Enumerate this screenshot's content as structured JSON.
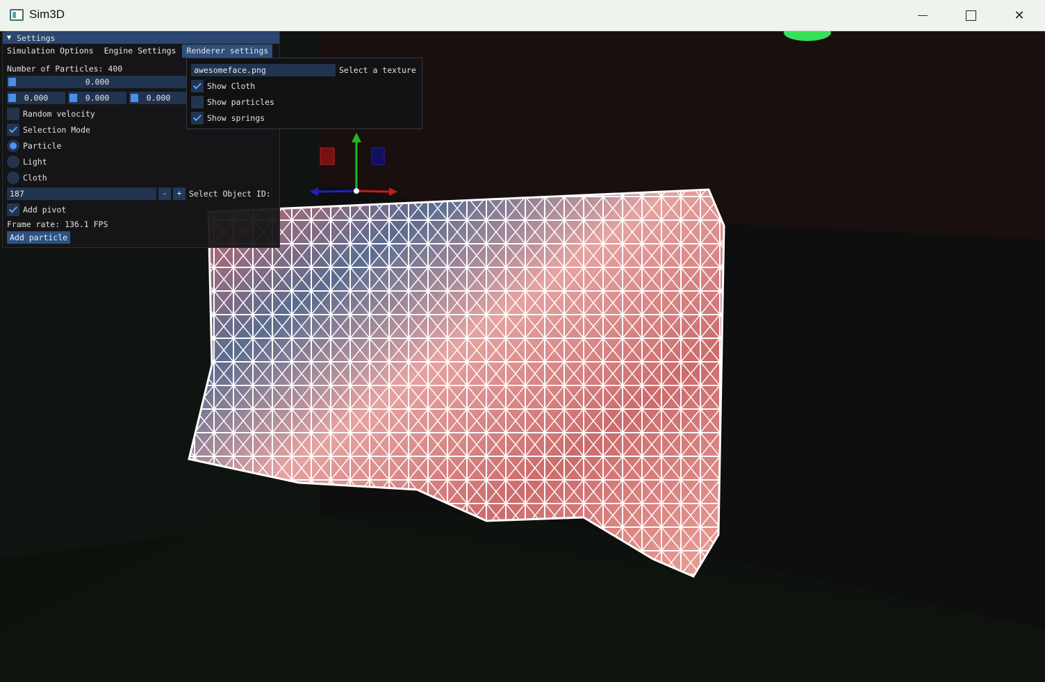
{
  "window": {
    "title": "Sim3D"
  },
  "settings": {
    "header": "Settings",
    "tabs": [
      "Simulation Options",
      "Engine Settings",
      "Renderer settings"
    ],
    "particles_label": "Number of Particles: 400",
    "slider_main": "0.000",
    "vec": [
      "0.000",
      "0.000",
      "0.000"
    ],
    "random_velocity": "Random velocity",
    "selection_mode": "Selection Mode",
    "radio": [
      "Particle",
      "Light",
      "Cloth"
    ],
    "object_id_value": "187",
    "minus": "-",
    "plus": "+",
    "object_id_label": "Select Object ID:",
    "add_pivot": "Add pivot",
    "frame_rate": "Frame rate: 136.1 FPS",
    "add_particle": "Add particle"
  },
  "renderer": {
    "texture_value": "awesomeface.png",
    "texture_label": "Select a texture",
    "show_cloth": "Show Cloth",
    "show_particles": "Show particles",
    "show_springs": "Show springs"
  }
}
